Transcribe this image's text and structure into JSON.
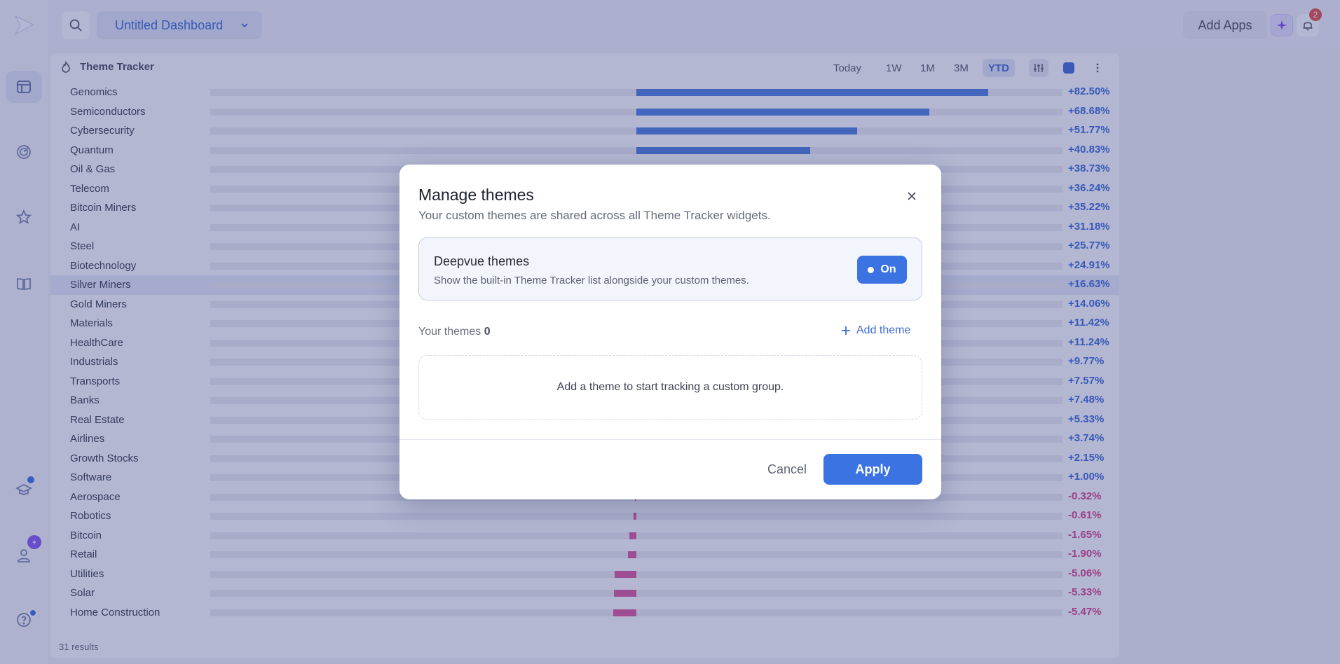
{
  "colors": {
    "accent": "#3b74e2",
    "positive": "#4f7fe0",
    "negative": "#e05a9e",
    "overlay": "rgba(44,56,128,0.36)"
  },
  "sidebar": {
    "items": [
      {
        "name": "dashboard",
        "icon": "dashboard-icon",
        "active": true
      },
      {
        "name": "radar",
        "icon": "radar-icon"
      },
      {
        "name": "favorites",
        "icon": "star-icon"
      },
      {
        "name": "learn",
        "icon": "book-icon"
      },
      {
        "name": "academy",
        "icon": "graduation-cap-icon"
      },
      {
        "name": "account",
        "icon": "user-icon"
      },
      {
        "name": "help",
        "icon": "help-icon"
      }
    ]
  },
  "topbar": {
    "dashboard_name": "Untitled Dashboard",
    "add_apps_label": "Add Apps",
    "notification_count": "2"
  },
  "widget": {
    "title": "Theme Tracker",
    "ranges": [
      "Today",
      "1W",
      "1M",
      "3M",
      "YTD"
    ],
    "active_range": "YTD",
    "footer": "31 results",
    "rows": [
      {
        "name": "Genomics",
        "value": 82.5,
        "label": "+82.50%"
      },
      {
        "name": "Semiconductors",
        "value": 68.68,
        "label": "+68.68%"
      },
      {
        "name": "Cybersecurity",
        "value": 51.77,
        "label": "+51.77%"
      },
      {
        "name": "Quantum",
        "value": 40.83,
        "label": "+40.83%"
      },
      {
        "name": "Oil & Gas",
        "value": 38.73,
        "label": "+38.73%"
      },
      {
        "name": "Telecom",
        "value": 36.24,
        "label": "+36.24%"
      },
      {
        "name": "Bitcoin Miners",
        "value": 35.22,
        "label": "+35.22%"
      },
      {
        "name": "AI",
        "value": 31.18,
        "label": "+31.18%"
      },
      {
        "name": "Steel",
        "value": 25.77,
        "label": "+25.77%"
      },
      {
        "name": "Biotechnology",
        "value": 24.91,
        "label": "+24.91%"
      },
      {
        "name": "Silver Miners",
        "value": 16.63,
        "label": "+16.63%",
        "highlight": true
      },
      {
        "name": "Gold Miners",
        "value": 14.06,
        "label": "+14.06%"
      },
      {
        "name": "Materials",
        "value": 11.42,
        "label": "+11.42%"
      },
      {
        "name": "HealthCare",
        "value": 11.24,
        "label": "+11.24%"
      },
      {
        "name": "Industrials",
        "value": 9.77,
        "label": "+9.77%"
      },
      {
        "name": "Transports",
        "value": 7.57,
        "label": "+7.57%"
      },
      {
        "name": "Banks",
        "value": 7.48,
        "label": "+7.48%"
      },
      {
        "name": "Real Estate",
        "value": 5.33,
        "label": "+5.33%"
      },
      {
        "name": "Airlines",
        "value": 3.74,
        "label": "+3.74%"
      },
      {
        "name": "Growth Stocks",
        "value": 2.15,
        "label": "+2.15%"
      },
      {
        "name": "Software",
        "value": 1.0,
        "label": "+1.00%"
      },
      {
        "name": "Aerospace",
        "value": -0.32,
        "label": "-0.32%"
      },
      {
        "name": "Robotics",
        "value": -0.61,
        "label": "-0.61%"
      },
      {
        "name": "Bitcoin",
        "value": -1.65,
        "label": "-1.65%"
      },
      {
        "name": "Retail",
        "value": -1.9,
        "label": "-1.90%"
      },
      {
        "name": "Utilities",
        "value": -5.06,
        "label": "-5.06%"
      },
      {
        "name": "Solar",
        "value": -5.33,
        "label": "-5.33%"
      },
      {
        "name": "Home Construction",
        "value": -5.47,
        "label": "-5.47%"
      }
    ]
  },
  "modal": {
    "title": "Manage themes",
    "subtitle": "Your custom themes are shared across all Theme Tracker widgets.",
    "deepvue": {
      "title": "Deepvue themes",
      "description": "Show the built-in Theme Tracker list alongside your custom themes.",
      "toggle_label": "On",
      "enabled": true
    },
    "your_themes_label": "Your themes",
    "your_themes_count": "0",
    "add_theme_label": "Add theme",
    "empty_message": "Add a theme to start tracking a custom group.",
    "cancel_label": "Cancel",
    "apply_label": "Apply"
  }
}
